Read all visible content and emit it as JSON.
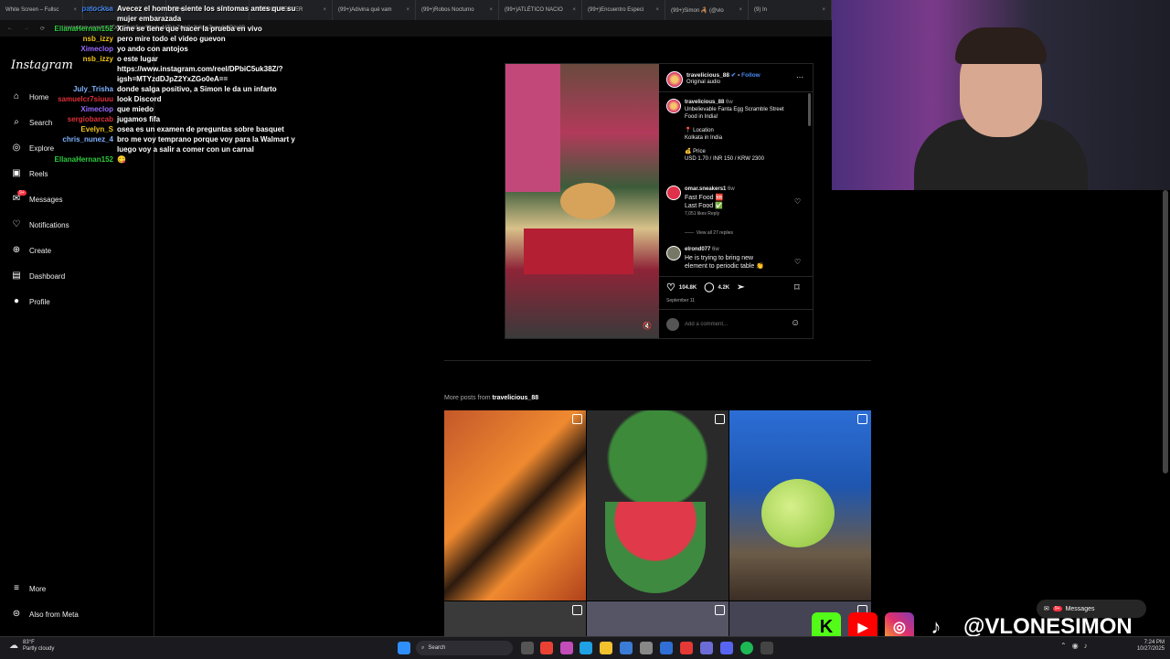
{
  "browser": {
    "tabs": [
      {
        "label": "White Screen – Fullsc"
      },
      {
        "label": "(99+) Pat"
      },
      {
        "label": "(99+) "
      },
      {
        "label": "BUENOS RECUER"
      },
      {
        "label": "(99+)Adivina qué vam"
      },
      {
        "label": "(99+)Robos Nocturno"
      },
      {
        "label": "(99+)ATLÉTICO NACIO"
      },
      {
        "label": "(99+)Encuentro Especi"
      },
      {
        "label": "(99+)Simon 🦂 (@vlo"
      },
      {
        "label": "(9) In"
      }
    ],
    "url": "instagram.com/reel/DOqT6ek5ev/?igsh=MTVoZmk2c2VkbnZvaw%3D%3D"
  },
  "sidebar": {
    "logo": "Instagram",
    "items": [
      {
        "label": "Home",
        "icon": "home-icon",
        "glyph": "⌂"
      },
      {
        "label": "Search",
        "icon": "search-icon",
        "glyph": "⌕"
      },
      {
        "label": "Explore",
        "icon": "compass-icon",
        "glyph": "◎"
      },
      {
        "label": "Reels",
        "icon": "reels-icon",
        "glyph": "▣"
      },
      {
        "label": "Messages",
        "icon": "messenger-icon",
        "glyph": "✉"
      },
      {
        "label": "Notifications",
        "icon": "heart-icon",
        "glyph": "♡"
      },
      {
        "label": "Create",
        "icon": "plus-icon",
        "glyph": "⊕"
      },
      {
        "label": "Dashboard",
        "icon": "dashboard-icon",
        "glyph": "▤"
      },
      {
        "label": "Profile",
        "icon": "profile-icon",
        "glyph": "●"
      }
    ],
    "messages_badge": "9+",
    "more": "More",
    "also_from_meta": "Also from Meta"
  },
  "chat": [
    {
      "user": "patocksa",
      "color": "#3a7be0",
      "text": "Avecez el hombre siente los síntomas antes que su"
    },
    {
      "user": "",
      "color": "#ffffff",
      "text": "mujer embarazada"
    },
    {
      "user": "EllanaHernan152",
      "color": "#2ecc40",
      "text": "Xime se tiene que hacer la prueba en vivo"
    },
    {
      "user": "nsb_izzy",
      "color": "#f0c419",
      "text": "pero mire todo el video guevon"
    },
    {
      "user": "Ximeclop",
      "color": "#9b6bff",
      "text": "yo ando con antojos"
    },
    {
      "user": "nsb_izzy",
      "color": "#f0c419",
      "text": "o este lugar"
    },
    {
      "user": "",
      "color": "#ffffff",
      "text": "https://www.instagram.com/reel/DPbiC5uk38Z/?"
    },
    {
      "user": "",
      "color": "#ffffff",
      "text": "igsh=MTYzdDJpZ2YxZGo0eA=="
    },
    {
      "user": "July_Trisha",
      "color": "#7fb2ff",
      "text": "donde salga positivo, a Simon le da un infarto"
    },
    {
      "user": "samuelcr7siuuu",
      "color": "#e0303a",
      "text": "look Discord"
    },
    {
      "user": "Ximeclop",
      "color": "#9b6bff",
      "text": "que miedo"
    },
    {
      "user": "sergiobarcab",
      "color": "#e0303a",
      "text": "jugamos fifa"
    },
    {
      "user": "Evelyn_S",
      "color": "#f0c419",
      "text": "osea es un examen de preguntas sobre basquet"
    },
    {
      "user": "chris_nunez_4",
      "color": "#7fb2ff",
      "text": "bro me voy temprano porque voy para la Walmart y"
    },
    {
      "user": "",
      "color": "#ffffff",
      "text": "luego voy a salir a comer con un carnal"
    },
    {
      "user": "EllanaHernan152",
      "color": "#2ecc40",
      "text": "😋"
    }
  ],
  "post": {
    "username": "travelicious_88",
    "follow": "Follow",
    "audio": "Original audio",
    "caption_user": "travelicious_88",
    "caption_time": "6w",
    "caption_lines": [
      "Unbelievable Fanta Egg Scramble Street",
      "Food in India!",
      "",
      "📍 Location",
      "Kolkata in India",
      "",
      "💰 Price",
      "USD 1.70 / INR 150 / KRW 2300"
    ],
    "comments": [
      {
        "user": "omar.sneakers1",
        "time": "6w",
        "lines": [
          "Fast Food 🆘",
          "Last Food ✅"
        ],
        "meta": "7,051 likes   Reply"
      },
      {
        "user": "elrond077",
        "time": "6w",
        "lines": [
          "He is trying to bring new",
          "element to periodic table 👏"
        ],
        "meta": ""
      }
    ],
    "view_replies": "View all 27 replies",
    "likes": "104.8K",
    "comments_count": "4.2K",
    "date": "September 11",
    "add_comment_placeholder": "Add a comment..."
  },
  "more_posts": {
    "prefix": "More posts from ",
    "user": "travelicious_88"
  },
  "overlay": {
    "messages_label": "Messages",
    "messages_badge": "9+",
    "handle": "@VLONESIMON",
    "kick_letter": "K"
  },
  "taskbar": {
    "weather_temp": "83°F",
    "weather_desc": "Partly cloudy",
    "search": "Search",
    "time": "7:24 PM",
    "date": "10/27/2025"
  }
}
